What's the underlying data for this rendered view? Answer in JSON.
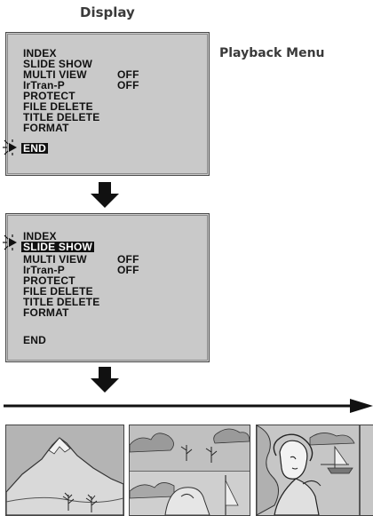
{
  "header": {
    "title": "Display"
  },
  "side_label": "Playback Menu",
  "screen1": {
    "items": [
      {
        "label": "INDEX",
        "value": ""
      },
      {
        "label": "SLIDE SHOW",
        "value": ""
      },
      {
        "label": "MULTI VIEW",
        "value": "OFF"
      },
      {
        "label": "IrTran-P",
        "value": "OFF"
      },
      {
        "label": "PROTECT",
        "value": ""
      },
      {
        "label": "FILE DELETE",
        "value": ""
      },
      {
        "label": "TITLE DELETE",
        "value": ""
      },
      {
        "label": "FORMAT",
        "value": ""
      }
    ],
    "end_label": "END",
    "selected": "END"
  },
  "screen2": {
    "items": [
      {
        "label": "INDEX",
        "value": ""
      },
      {
        "label": "SLIDE SHOW",
        "value": ""
      },
      {
        "label": "MULTI VIEW",
        "value": "OFF"
      },
      {
        "label": "IrTran-P",
        "value": "OFF"
      },
      {
        "label": "PROTECT",
        "value": ""
      },
      {
        "label": "FILE DELETE",
        "value": ""
      },
      {
        "label": "TITLE DELETE",
        "value": ""
      },
      {
        "label": "FORMAT",
        "value": ""
      }
    ],
    "end_label": "END",
    "selected": "SLIDE SHOW"
  },
  "icons": [
    "cursor-pointer-icon",
    "down-arrow-icon",
    "right-arrow-icon"
  ],
  "colors": {
    "screen_bg": "#c9c9c9",
    "panel_bg": "#b9b9b9",
    "arrow": "#111111"
  }
}
